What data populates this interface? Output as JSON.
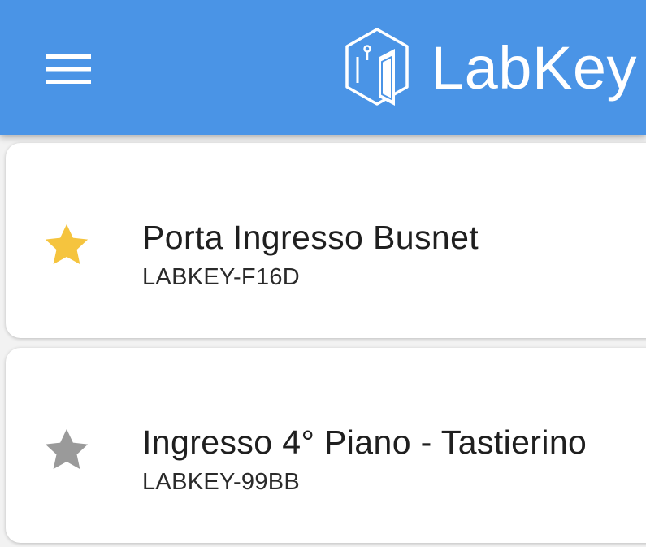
{
  "app_bar": {
    "brand_name": "LabKey",
    "background_color": "#4a94e6",
    "menu_icon": "hamburger-menu-icon",
    "logo_icon": "labkey-hexagon-door-logo"
  },
  "locks": [
    {
      "name": "Porta Ingresso Busnet",
      "id": "LABKEY-F16D",
      "favorite": true,
      "star_color": "#f5c43e",
      "icon": "star-icon"
    },
    {
      "name": "Ingresso 4° Piano - Tastierino",
      "id": "LABKEY-99BB",
      "favorite": false,
      "star_color": "#9a9a9a",
      "icon": "star-icon"
    }
  ]
}
